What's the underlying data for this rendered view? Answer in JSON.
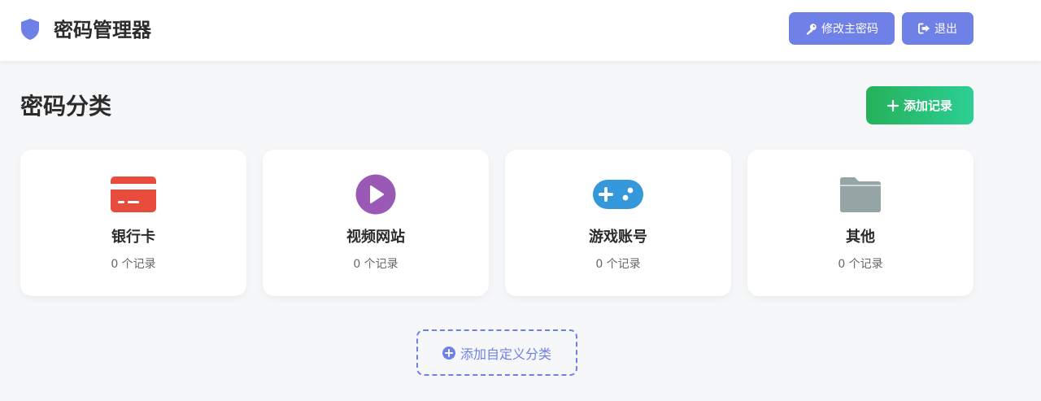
{
  "header": {
    "app_title": "密码管理器",
    "logo_icon": "shield-icon",
    "change_master_password_label": "修改主密码",
    "change_master_password_icon": "key-icon",
    "logout_label": "退出",
    "logout_icon": "sign-out-icon"
  },
  "main": {
    "section_title": "密码分类",
    "add_record_label": "添加记录",
    "add_record_icon": "plus-icon",
    "categories": [
      {
        "name": "银行卡",
        "count_text": "0 个记录",
        "icon": "credit-card-icon",
        "color": "#e74c3c"
      },
      {
        "name": "视频网站",
        "count_text": "0 个记录",
        "icon": "play-circle-icon",
        "color": "#9b59b6"
      },
      {
        "name": "游戏账号",
        "count_text": "0 个记录",
        "icon": "gamepad-icon",
        "color": "#3498db"
      },
      {
        "name": "其他",
        "count_text": "0 个记录",
        "icon": "folder-icon",
        "color": "#95a5a6"
      }
    ],
    "add_custom_category_label": "添加自定义分类",
    "add_custom_category_icon": "plus-circle-icon"
  },
  "colors": {
    "primary": "#6f80e6",
    "success_start": "#25b15a",
    "success_end": "#2ccf94",
    "background": "#f6f7f9"
  }
}
